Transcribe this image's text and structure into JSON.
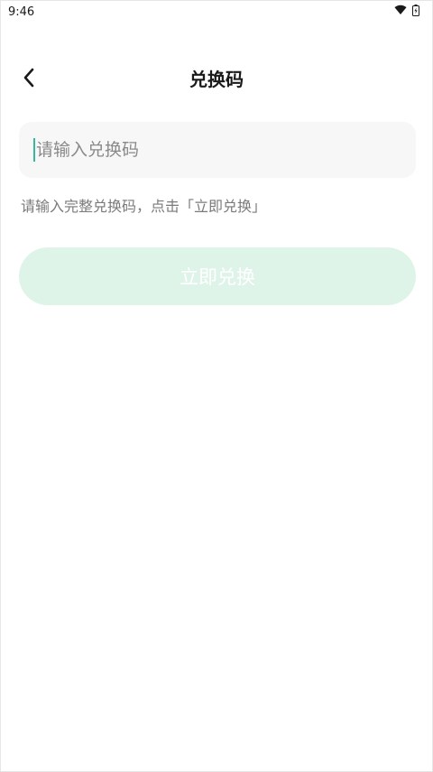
{
  "status_bar": {
    "time": "9:46",
    "wifi_icon": "wifi-icon",
    "battery_icon": "battery-icon"
  },
  "header": {
    "back_icon": "chevron-left-icon",
    "title": "兑换码"
  },
  "form": {
    "input_value": "",
    "input_placeholder": "请输入兑换码",
    "hint": "请输入完整兑换码，点击「立即兑换」",
    "submit_label": "立即兑换"
  },
  "colors": {
    "button_bg": "#dff4e9",
    "caret": "#35b8a0"
  }
}
